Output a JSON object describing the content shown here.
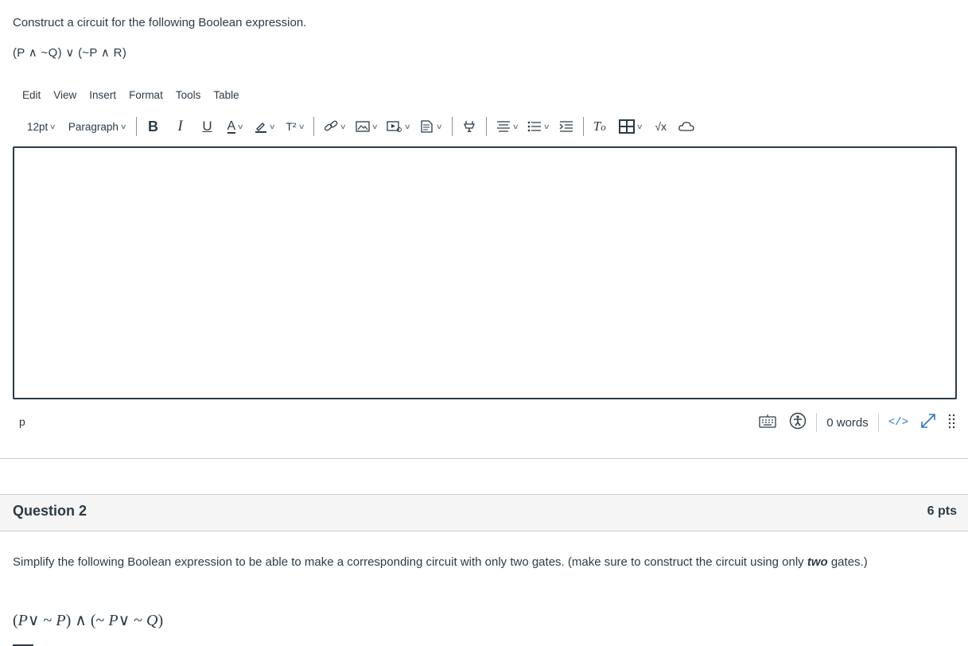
{
  "question1": {
    "prompt": "Construct a circuit for the following Boolean expression.",
    "expression": "(P ∧ ~Q) ∨ (~P ∧ R)"
  },
  "editor": {
    "menu": [
      "Edit",
      "View",
      "Insert",
      "Format",
      "Tools",
      "Table"
    ],
    "toolbar": {
      "font_size": "12pt",
      "block_format": "Paragraph",
      "superscript_label": "T²",
      "math_label": "√x"
    },
    "content": "",
    "status": {
      "path": "p",
      "word_count": "0 words",
      "html_toggle": "</>"
    }
  },
  "question2": {
    "title": "Question 2",
    "points": "6 pts",
    "prompt_before": "Simplify the following Boolean expression to be able to make a corresponding circuit with only two gates. (make sure to construct the circuit using only ",
    "prompt_emphasis": "two",
    "prompt_after": " gates.)",
    "expression": "(P∨ ~ P) ∧ (~ P∨ ~ Q)"
  },
  "colors": {
    "text": "#2d3b45",
    "link": "#2b7abc",
    "border": "#c7cdd1",
    "header_bg": "#f5f5f5"
  },
  "icons": [
    "bold-icon",
    "italic-icon",
    "underline-icon",
    "text-color-icon",
    "highlight-icon",
    "superscript-icon",
    "link-icon",
    "image-icon",
    "media-icon",
    "document-icon",
    "apps-icon",
    "align-icon",
    "list-icon",
    "indent-icon",
    "clear-format-icon",
    "table-icon",
    "math-icon",
    "cloud-icon",
    "keyboard-icon",
    "accessibility-icon",
    "fullscreen-icon",
    "resize-handle-icon"
  ]
}
